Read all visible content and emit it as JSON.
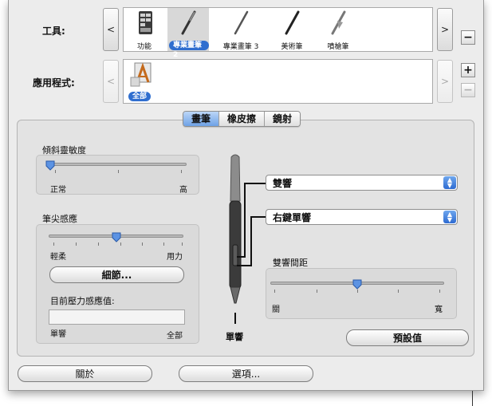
{
  "tools_row": {
    "label": "工具:",
    "prev": "<",
    "next": ">",
    "remove": "−",
    "items": [
      {
        "label": "功能",
        "icon": "functions-icon",
        "selected": false
      },
      {
        "label": "專業畫筆 2",
        "icon": "pen-icon",
        "selected": true
      },
      {
        "label": "專業畫筆 3",
        "icon": "pen-icon",
        "selected": false
      },
      {
        "label": "美術筆",
        "icon": "art-pen-icon",
        "selected": false
      },
      {
        "label": "噴槍筆",
        "icon": "airbrush-icon",
        "selected": false
      }
    ]
  },
  "apps_row": {
    "label": "應用程式:",
    "prev": "<",
    "next": ">",
    "add": "+",
    "remove": "−",
    "items": [
      {
        "label": "全部",
        "icon": "all-apps-icon",
        "selected": true
      }
    ]
  },
  "tabs": [
    {
      "label": "畫筆",
      "active": true
    },
    {
      "label": "橡皮擦",
      "active": false
    },
    {
      "label": "鏡射",
      "active": false
    }
  ],
  "tilt": {
    "title": "傾斜靈敏度",
    "left": "正常",
    "right": "高",
    "value_fraction": 0.0
  },
  "tip": {
    "title": "筆尖感應",
    "left": "輕柔",
    "right": "用力",
    "value_fraction": 0.5,
    "details_button": "細節...",
    "pressure_title": "目前壓力感應值:",
    "pressure_left": "單響",
    "pressure_right": "全部"
  },
  "pen": {
    "tip_label": "單響",
    "upper_button_value": "雙響",
    "lower_button_value": "右鍵單響"
  },
  "double_click": {
    "title": "雙響間距",
    "left": "關",
    "right": "寬",
    "value_fraction": 0.5
  },
  "defaults_button": "預設值",
  "about_button": "關於",
  "options_button": "選項..."
}
